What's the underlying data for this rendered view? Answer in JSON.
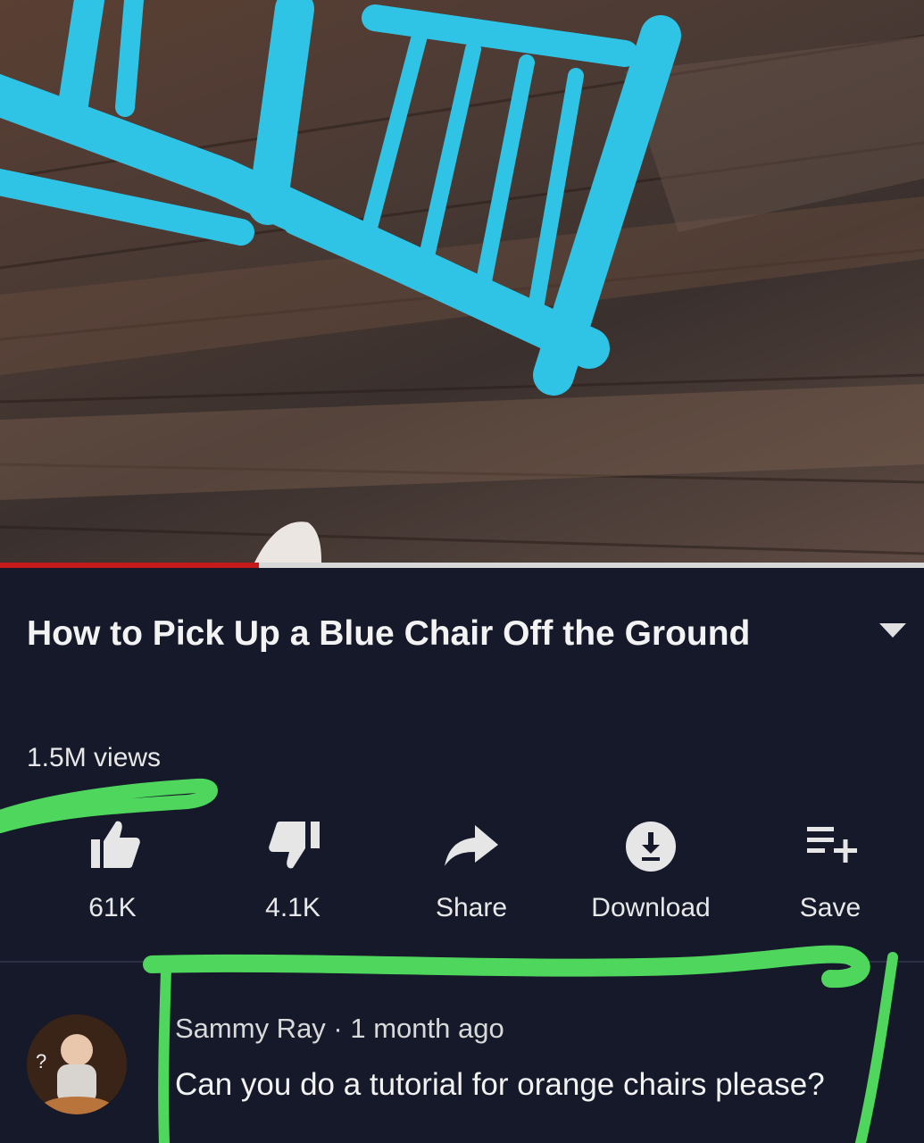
{
  "video": {
    "progress_fraction": 0.28
  },
  "video_info": {
    "title": "How to Pick Up a Blue Chair Off the Ground",
    "views": "1.5M views"
  },
  "actions": [
    {
      "label": "61K",
      "icon": "thumbs-up-icon"
    },
    {
      "label": "4.1K",
      "icon": "thumbs-down-icon"
    },
    {
      "label": "Share",
      "icon": "share-arrow-icon"
    },
    {
      "label": "Download",
      "icon": "download-icon"
    },
    {
      "label": "Save",
      "icon": "playlist-add-icon"
    }
  ],
  "comment": {
    "author_line": "Sammy Ray · 1 month ago",
    "text": "Can you do a tutorial for orange chairs please?"
  },
  "colors": {
    "background": "#15192a",
    "progress": "#c41a1a",
    "highlight_marker": "#4fd65c",
    "chair": "#2fc3e6"
  }
}
